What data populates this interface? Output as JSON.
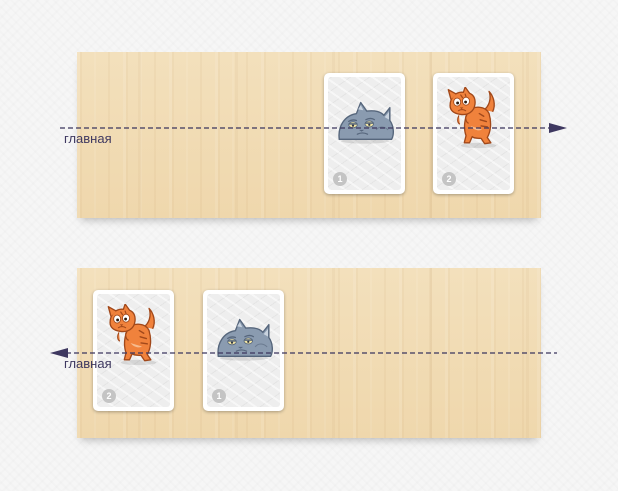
{
  "rows": [
    {
      "direction": "right",
      "axis_label": "главная",
      "cards": [
        {
          "number": "1",
          "cat": "grey-sleepy-cat-icon"
        },
        {
          "number": "2",
          "cat": "orange-scared-cat-icon"
        }
      ]
    },
    {
      "direction": "left",
      "axis_label": "главная",
      "cards": [
        {
          "number": "2",
          "cat": "orange-scared-cat-icon"
        },
        {
          "number": "1",
          "cat": "grey-sleepy-cat-icon"
        }
      ]
    }
  ],
  "colors": {
    "axis": "#3e3860",
    "board": "#f1dcb4",
    "grey_cat": "#8a9bb0",
    "orange_cat": "#f0823c",
    "badge": "#c4c4c4"
  }
}
